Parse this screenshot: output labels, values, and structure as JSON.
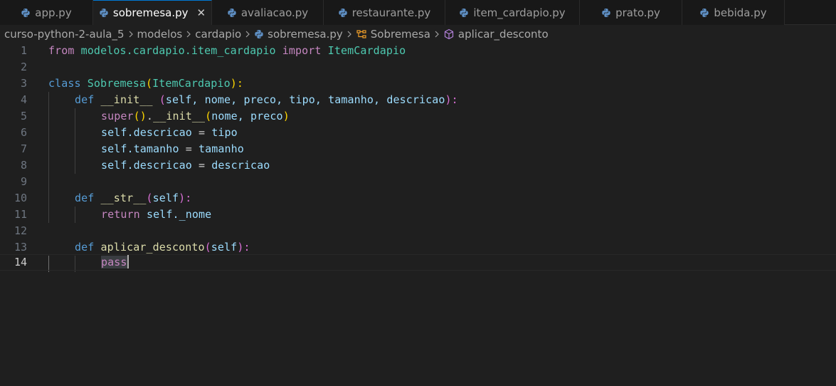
{
  "tabs": [
    {
      "label": "app.py",
      "active": false
    },
    {
      "label": "sobremesa.py",
      "active": true
    },
    {
      "label": "avaliacao.py",
      "active": false
    },
    {
      "label": "restaurante.py",
      "active": false
    },
    {
      "label": "item_cardapio.py",
      "active": false
    },
    {
      "label": "prato.py",
      "active": false
    },
    {
      "label": "bebida.py",
      "active": false
    }
  ],
  "tab_close_glyph": "✕",
  "breadcrumb": {
    "project": "curso-python-2-aula_5",
    "folder1": "modelos",
    "folder2": "cardapio",
    "file": "sobremesa.py",
    "class": "Sobremesa",
    "method": "aplicar_desconto"
  },
  "icons": {
    "python": "python-file-icon",
    "chevron": "chevron-right-icon",
    "class": "class-symbol-icon",
    "method": "method-symbol-icon",
    "close": "close-icon"
  },
  "colors": {
    "accent": "#0078d4",
    "keyword": "#c586c0",
    "storage": "#569cd6",
    "class": "#4ec9b0",
    "function": "#dcdcaa",
    "variable": "#9cdcfe"
  },
  "editor": {
    "current_line": "14",
    "line_numbers": [
      "1",
      "2",
      "3",
      "4",
      "5",
      "6",
      "7",
      "8",
      "9",
      "10",
      "11",
      "12",
      "13",
      "14"
    ],
    "code": {
      "l1": {
        "from": "from",
        "module": "modelos.cardapio.item_cardapio",
        "import": "import",
        "name": "ItemCardapio"
      },
      "l3": {
        "class": "class",
        "name": "Sobremesa",
        "open": "(",
        "base": "ItemCardapio",
        "close": "):"
      },
      "l4": {
        "def": "def",
        "name": "__init__",
        "space": " ",
        "open": "(",
        "params": "self, nome, preco, tipo, tamanho, descricao",
        "close": "):"
      },
      "l5": {
        "fn": "super",
        "call": "()",
        "dot": ".",
        "name": "__init__",
        "open": "(",
        "args": "nome, preco",
        "close": ")"
      },
      "l6": {
        "self": "self.descricao",
        "eq": " = ",
        "val": "tipo"
      },
      "l7": {
        "self": "self.tamanho",
        "eq": " = ",
        "val": "tamanho"
      },
      "l8": {
        "self": "self.descricao",
        "eq": " = ",
        "val": "descricao"
      },
      "l10": {
        "def": "def",
        "name": "__str__",
        "open": "(",
        "params": "self",
        "close": "):"
      },
      "l11": {
        "ret": "return",
        "val": "self._nome"
      },
      "l13": {
        "def": "def",
        "name": "aplicar_desconto",
        "open": "(",
        "params": "self",
        "close": "):"
      },
      "l14": {
        "kw": "pass"
      }
    }
  }
}
